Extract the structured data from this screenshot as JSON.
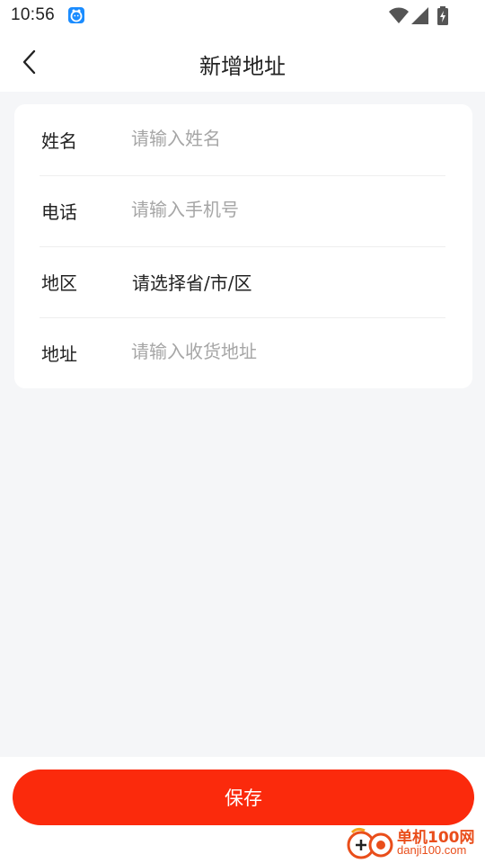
{
  "status_bar": {
    "time": "10:56",
    "icons": [
      "app-notification-icon",
      "wifi-icon",
      "cellular-signal-icon",
      "battery-charging-icon"
    ]
  },
  "header": {
    "back_icon": "chevron-left-icon",
    "title": "新增地址"
  },
  "form": {
    "rows": [
      {
        "label": "姓名",
        "placeholder": "请输入姓名",
        "value": ""
      },
      {
        "label": "电话",
        "placeholder": "请输入手机号",
        "value": ""
      },
      {
        "label": "地区",
        "select_text": "请选择省/市/区"
      },
      {
        "label": "地址",
        "placeholder": "请输入收货地址",
        "value": ""
      }
    ]
  },
  "actions": {
    "save_label": "保存"
  },
  "watermark": {
    "text_cn": "单机100网",
    "text_en": "danji100.com"
  },
  "colors": {
    "accent": "#fb2a0c",
    "page_background": "#f5f6f8",
    "card_background": "#ffffff",
    "placeholder": "#a6a6a6",
    "watermark": "#e94e1b"
  }
}
